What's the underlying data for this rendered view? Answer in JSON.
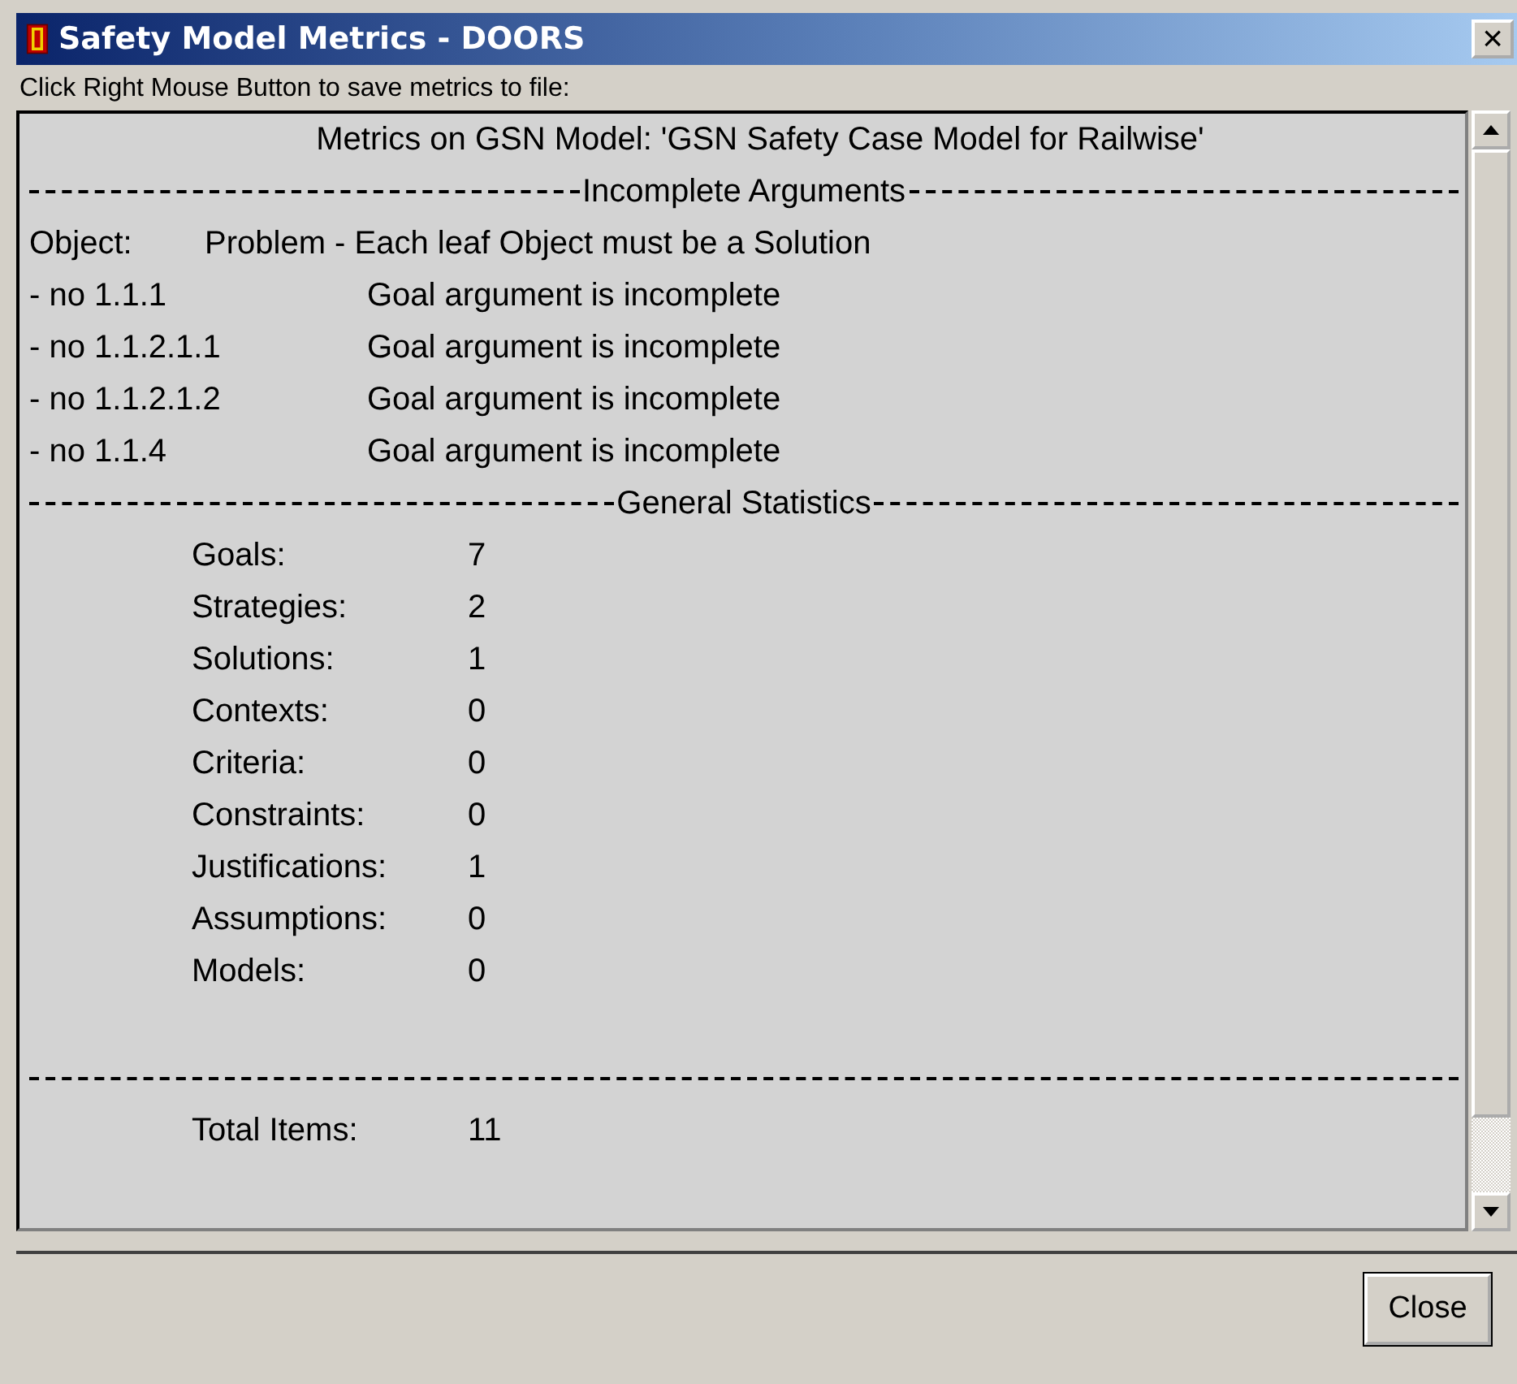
{
  "window": {
    "title": "Safety Model Metrics - DOORS",
    "close_glyph": "×"
  },
  "hint": "Click Right Mouse Button to save metrics to file:",
  "report": {
    "heading": "Metrics on GSN Model: 'GSN Safety Case Model for Railwise'",
    "incomplete": {
      "title": "Incomplete Arguments",
      "object_label": "Object:",
      "object_text": "Problem - Each leaf Object must be a Solution",
      "rows": [
        {
          "id": "- no 1.1.1",
          "message": "Goal argument is incomplete"
        },
        {
          "id": "- no 1.1.2.1.1",
          "message": "Goal argument is incomplete"
        },
        {
          "id": "- no 1.1.2.1.2",
          "message": "Goal argument is incomplete"
        },
        {
          "id": "- no 1.1.4",
          "message": "Goal argument is incomplete"
        }
      ]
    },
    "statistics": {
      "title": "General Statistics",
      "items": [
        {
          "label": "Goals:",
          "value": "7"
        },
        {
          "label": "Strategies:",
          "value": "2"
        },
        {
          "label": "Solutions:",
          "value": "1"
        },
        {
          "label": "Contexts:",
          "value": "0"
        },
        {
          "label": "Criteria:",
          "value": "0"
        },
        {
          "label": "Constraints:",
          "value": "0"
        },
        {
          "label": "Justifications:",
          "value": "1"
        },
        {
          "label": "Assumptions:",
          "value": "0"
        },
        {
          "label": "Models:",
          "value": "0"
        }
      ]
    },
    "total": {
      "label": "Total Items:",
      "value": "11"
    }
  },
  "buttons": [
    {
      "label": "Close"
    }
  ]
}
